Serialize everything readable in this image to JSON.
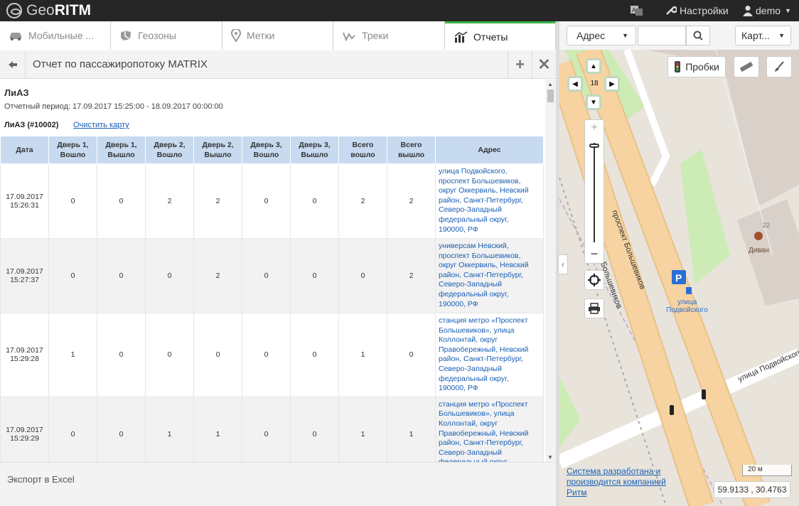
{
  "app": {
    "logo_geo": "Geo",
    "logo_ritm": "RITM"
  },
  "topbar": {
    "settings": "Настройки",
    "user": "demo"
  },
  "tabs": [
    {
      "label": "Мобильные ...",
      "icon": "car-icon"
    },
    {
      "label": "Геозоны",
      "icon": "geozone-icon"
    },
    {
      "label": "Метки",
      "icon": "pin-icon"
    },
    {
      "label": "Треки",
      "icon": "track-icon"
    },
    {
      "label": "Отчеты",
      "icon": "chart-icon",
      "active": true
    }
  ],
  "report": {
    "title": "Отчет по пассажиропотоку MATRIX",
    "vehicle": "ЛиАЗ",
    "period": "Отчетный период: 17.09.2017 15:25:00 - 18.09.2017 00:00:00",
    "vehicle_id": "ЛиАЗ (#10002)",
    "clear_map": "Очистить карту",
    "columns": [
      "Дата",
      "Дверь 1, Вошло",
      "Дверь 1, Вышло",
      "Дверь 2, Вошло",
      "Дверь 2, Вышло",
      "Дверь 3, Вошло",
      "Дверь 3, Вышло",
      "Всего вошло",
      "Всего вышло",
      "Адрес"
    ],
    "rows": [
      {
        "date": "17.09.2017",
        "time": "15:26:31",
        "vals": [
          "0",
          "0",
          "2",
          "2",
          "0",
          "0",
          "2",
          "2"
        ],
        "addr": [
          "улица Подвойского,",
          "проспект Большевиков,",
          "округ Оккервиль, Невский",
          "район, Санкт-Петербург,",
          "Северо-Западный",
          "федеральный округ,",
          "190000, РФ"
        ]
      },
      {
        "date": "17.09.2017",
        "time": "15:27:37",
        "vals": [
          "0",
          "0",
          "0",
          "2",
          "0",
          "0",
          "0",
          "2"
        ],
        "addr": [
          "универсам Невский,",
          "проспект Большевиков,",
          "округ Оккервиль, Невский",
          "район, Санкт-Петербург,",
          "Северо-Западный",
          "федеральный округ,",
          "190000, РФ"
        ]
      },
      {
        "date": "17.09.2017",
        "time": "15:29:28",
        "vals": [
          "1",
          "0",
          "0",
          "0",
          "0",
          "0",
          "1",
          "0"
        ],
        "addr": [
          "станция метро «Проспект",
          "Большевиков», улица",
          "Коллонтай, округ",
          "Правобережный, Невский",
          "район, Санкт-Петербург,",
          "Северо-Западный",
          "федеральный округ,",
          "190000, РФ"
        ]
      },
      {
        "date": "17.09.2017",
        "time": "15:29:29",
        "vals": [
          "0",
          "0",
          "1",
          "1",
          "0",
          "0",
          "1",
          "1"
        ],
        "addr": [
          "станция метро «Проспект",
          "Большевиков», улица",
          "Коллонтай, округ",
          "Правобережный, Невский",
          "район, Санкт-Петербург,",
          "Северо-Западный",
          "федеральный округ,"
        ]
      }
    ],
    "export": "Экспорт в Excel"
  },
  "map": {
    "search_type": "Адрес",
    "map_type": "Карт...",
    "traffic": "Пробки",
    "zoom": "18",
    "labels": {
      "street1": "проспект Большевиков",
      "street2": "Большевиков",
      "street3": "улица Подвойского",
      "stop": "улица",
      "stop2": "Подвойского",
      "cafe": "Диван",
      "house": "22",
      "parking": "P"
    },
    "copyright": "Система разработана и производится компанией Ритм",
    "scale": "20 м",
    "coords": "59.9133 , 30.4763"
  }
}
